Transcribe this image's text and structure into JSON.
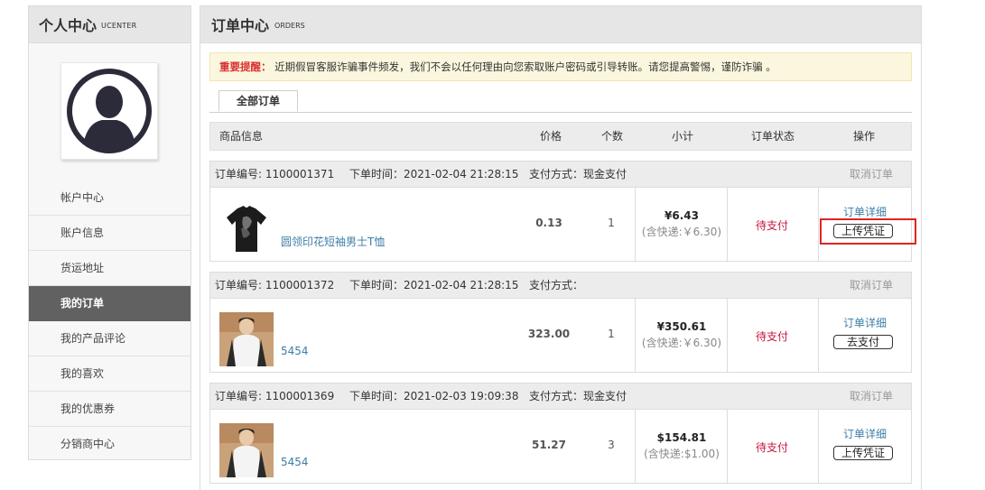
{
  "sidebar": {
    "title": "个人中心",
    "subtitle": "UCENTER",
    "menu": [
      {
        "label": "帐户中心",
        "active": false
      },
      {
        "label": "账户信息",
        "active": false
      },
      {
        "label": "货运地址",
        "active": false
      },
      {
        "label": "我的订单",
        "active": true
      },
      {
        "label": "我的产品评论",
        "active": false
      },
      {
        "label": "我的喜欢",
        "active": false
      },
      {
        "label": "我的优惠券",
        "active": false
      },
      {
        "label": "分销商中心",
        "active": false
      }
    ]
  },
  "main": {
    "title": "订单中心",
    "subtitle": "ORDERS",
    "notice_label": "重要提醒：",
    "notice_text": "近期假冒客服诈骗事件频发，我们不会以任何理由向您索取账户密码或引导转账。请您提高警惕，谨防诈骗 。",
    "tab_all": "全部订单",
    "columns": {
      "product": "商品信息",
      "price": "价格",
      "qty": "个数",
      "subtotal": "小计",
      "status": "订单状态",
      "action": "操作"
    }
  },
  "orders": [
    {
      "number": "订单编号: 1100001371",
      "time": "下单时间：2021-02-04 21:28:15",
      "payment": "支付方式：现金支付",
      "cancel": "取消订单",
      "product_name": "圆领印花短袖男士T恤",
      "product_image": "black-tshirt-image",
      "price": "0.13",
      "qty": "1",
      "total": "¥6.43",
      "shipping": "(含快递:￥6.30)",
      "status": "待支付",
      "detail": "订单详细",
      "button": "上传凭证"
    },
    {
      "number": "订单编号: 1100001372",
      "time": "下单时间：2021-02-04 21:28:15",
      "payment": "支付方式：",
      "cancel": "取消订单",
      "product_name": "5454",
      "product_image": "model-photo-image",
      "price": "323.00",
      "qty": "1",
      "total": "¥350.61",
      "shipping": "(含快递:￥6.30)",
      "status": "待支付",
      "detail": "订单详细",
      "button": "去支付"
    },
    {
      "number": "订单编号: 1100001369",
      "time": "下单时间：2021-02-03 19:09:38",
      "payment": "支付方式：现金支付",
      "cancel": "取消订单",
      "product_name": "5454",
      "product_image": "model-photo-image",
      "price": "51.27",
      "qty": "3",
      "total": "$154.81",
      "shipping": "(含快递:$1.00)",
      "status": "待支付",
      "detail": "订单详细",
      "button": "上传凭证"
    }
  ],
  "colors": {
    "warning": "#d93030",
    "status": "#c8163f",
    "link": "#3d7ea6",
    "highlight": "#e02424",
    "active_menu": "#616161"
  }
}
